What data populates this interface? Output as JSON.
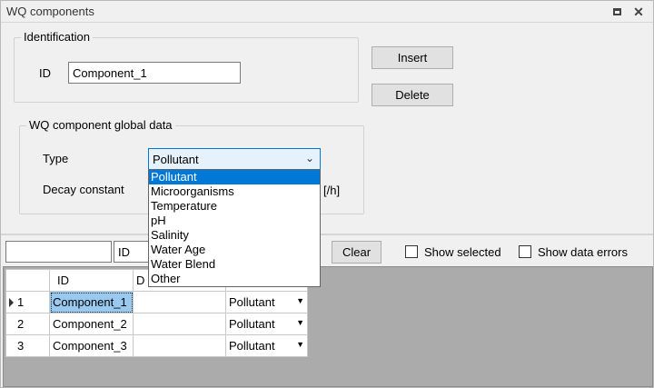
{
  "window": {
    "title": "WQ components"
  },
  "identification": {
    "legend": "Identification",
    "id_label": "ID",
    "id_value": "Component_1"
  },
  "buttons": {
    "insert": "Insert",
    "delete": "Delete"
  },
  "global": {
    "legend": "WQ component global data",
    "type_label": "Type",
    "type_value": "Pollutant",
    "decay_label": "Decay constant",
    "decay_unit": "[/h]",
    "type_options": [
      "Pollutant",
      "Microorganisms",
      "Temperature",
      "pH",
      "Salinity",
      "Water Age",
      "Water Blend",
      "Other"
    ]
  },
  "toolbar": {
    "filter_field": "ID",
    "clear_label": "Clear",
    "show_selected": "Show selected",
    "show_errors": "Show data errors"
  },
  "grid": {
    "headers": [
      "ID",
      "D"
    ],
    "rows": [
      {
        "num": "1",
        "id": "Component_1",
        "decay": "",
        "type": "Pollutant",
        "current": true
      },
      {
        "num": "2",
        "id": "Component_2",
        "decay": "",
        "type": "Pollutant",
        "current": false
      },
      {
        "num": "3",
        "id": "Component_3",
        "decay": "",
        "type": "Pollutant",
        "current": false
      }
    ]
  },
  "icons": {
    "restore": "restore-icon",
    "close": "close-icon",
    "chevron": "chevron-down-icon",
    "row_indicator": "row-pointer-icon"
  }
}
